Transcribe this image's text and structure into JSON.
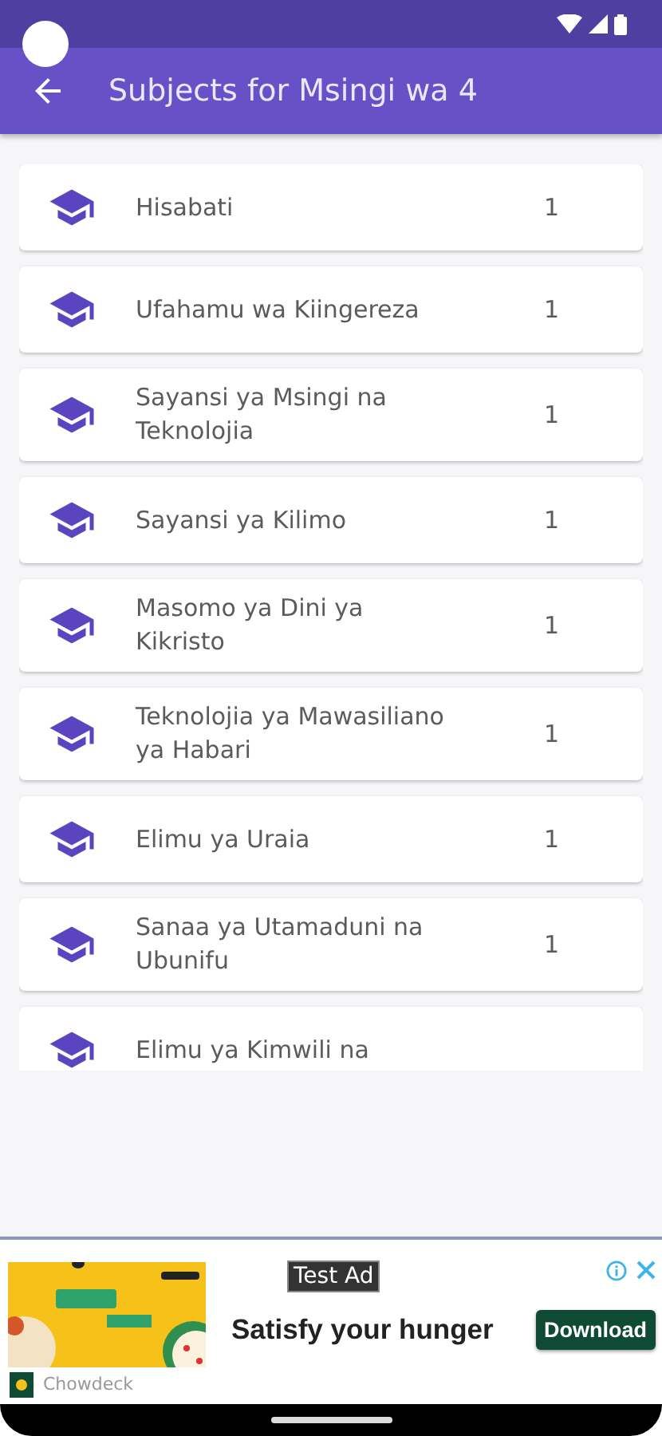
{
  "app_bar": {
    "title": "Subjects for Msingi wa 4"
  },
  "subjects": [
    {
      "name": "Hisabati",
      "count": "1"
    },
    {
      "name": "Ufahamu wa Kiingereza",
      "count": "1"
    },
    {
      "name": "Sayansi ya Msingi na Teknolojia",
      "count": "1"
    },
    {
      "name": "Sayansi ya Kilimo",
      "count": "1"
    },
    {
      "name": "Masomo ya Dini ya Kikristo",
      "count": "1"
    },
    {
      "name": "Teknolojia ya Mawasiliano ya Habari",
      "count": "1"
    },
    {
      "name": "Elimu ya Uraia",
      "count": "1"
    },
    {
      "name": "Sanaa ya Utamaduni na Ubunifu",
      "count": "1"
    },
    {
      "name": "Elimu ya Kimwili na"
    }
  ],
  "ad": {
    "badge": "Test Ad",
    "headline": "Satisfy your hunger",
    "button": "Download",
    "advertiser": "Chowdeck"
  }
}
